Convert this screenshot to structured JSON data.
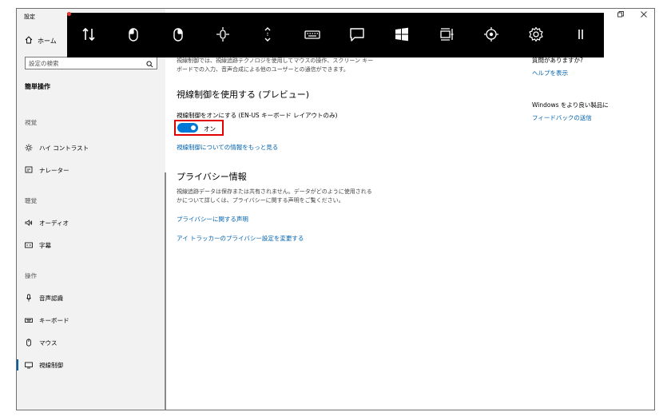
{
  "window": {
    "title": "設定"
  },
  "sidebar": {
    "home": "ホーム",
    "search_placeholder": "設定の検索",
    "section": "簡単操作",
    "categories": {
      "vision": "視覚",
      "hearing": "聴覚",
      "interaction": "操作"
    },
    "items": {
      "high_contrast": "ハイ コントラスト",
      "narrator": "ナレーター",
      "audio": "オーディオ",
      "captions": "字幕",
      "speech": "音声認識",
      "keyboard": "キーボード",
      "mouse": "マウス",
      "eye_control": "視線制御"
    }
  },
  "main": {
    "intro_line1": "視線制御では、視線追跡テクノロジを使用してマウスの操作、スクリーン キー",
    "intro_line2": "ボードでの入力、音声合成による他のユーザーとの通信ができます。",
    "heading": "視線制御を使用する (プレビュー)",
    "toggle_caption": "視線制御をオンにする (EN-US キーボード レイアウトのみ)",
    "toggle_state": "オン",
    "learn_more": "視線制御についての情報をもっと見る",
    "privacy_heading": "プライバシー情報",
    "privacy_line1": "視線追跡データは保存または共有されません。データがどのように使用される",
    "privacy_line2": "かについて詳しくは、プライバシーに関する声明をご覧ください。",
    "privacy_link": "プライバシーに関する声明",
    "tracker_link": "アイ トラッカーのプライバシー設定を変更する"
  },
  "right": {
    "question": "質問がありますか?",
    "help_link": "ヘルプを表示",
    "improve": "Windows をより良い製品に",
    "feedback_link": "フィードバックの送信"
  },
  "toolbar": {
    "icons": [
      "swap-position-icon",
      "left-click-icon",
      "right-click-icon",
      "precise-mouse-icon",
      "scroll-icon",
      "keyboard-icon",
      "text-to-speech-icon",
      "start-icon",
      "switch-task-icon",
      "eye-cursor-icon",
      "settings-icon",
      "pause-icon"
    ]
  },
  "colors": {
    "accent": "#0078d7",
    "link": "#0063b1",
    "highlight": "#e00000",
    "toolbar_bg": "#000000"
  }
}
